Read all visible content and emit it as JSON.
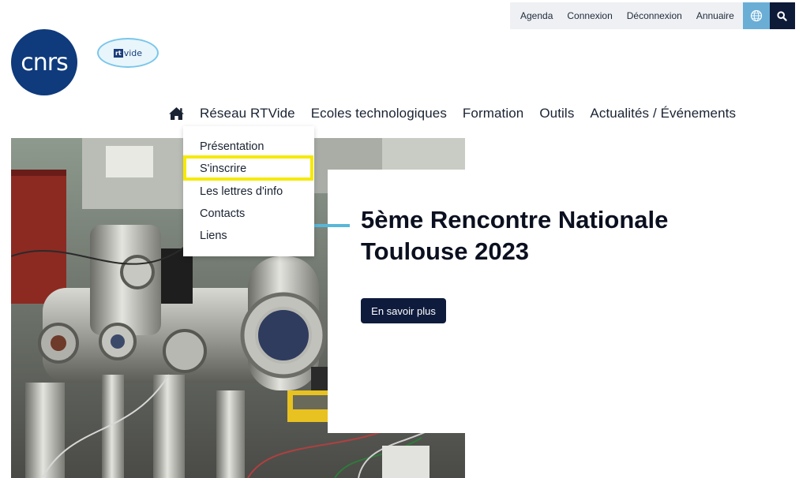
{
  "topbar": {
    "links": [
      "Agenda",
      "Connexion",
      "Déconnexion",
      "Annuaire"
    ],
    "globe_icon": "globe-icon",
    "search_icon": "search-icon",
    "globe_bg": "#6aaed6",
    "search_bg": "#0d1a38"
  },
  "logos": {
    "cnrs": "cnrs",
    "rtvide_box": "rt",
    "rtvide_text": "vide"
  },
  "nav": {
    "home_icon": "home-icon",
    "items": [
      "Réseau RTVide",
      "Ecoles technologiques",
      "Formation",
      "Outils",
      "Actualités / Événements"
    ]
  },
  "dropdown": {
    "items": [
      "Présentation",
      "S'inscrire",
      "Les lettres d'info",
      "Contacts",
      "Liens"
    ],
    "highlighted_item": "S'inscrire",
    "highlight_color": "#f6ea00"
  },
  "hero": {
    "title_line1": "5ème Rencontre Nationale",
    "title_line2": "Toulouse 2023",
    "button_label": "En savoir plus",
    "accent_color": "#58b7d9",
    "button_bg": "#0e1b3d"
  }
}
